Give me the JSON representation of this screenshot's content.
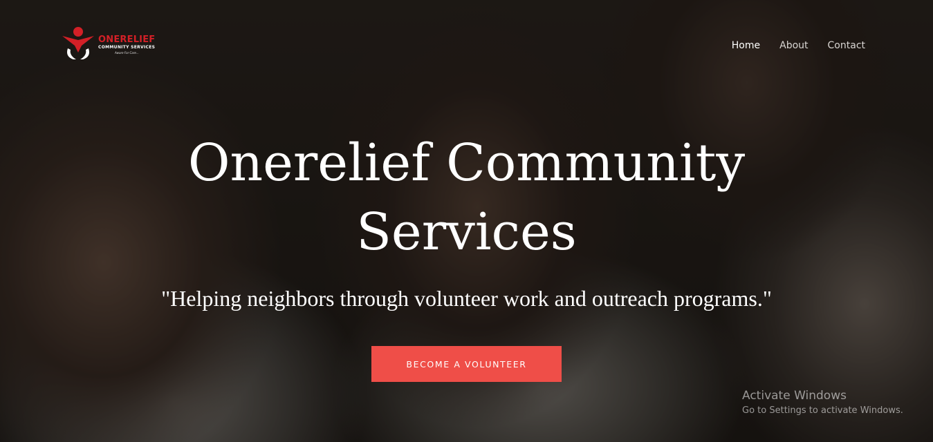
{
  "logo": {
    "name": "ONERELIEF",
    "subtitle": "COMMUNITY SERVICES",
    "tagline": "Aware For Care..."
  },
  "nav": {
    "items": [
      {
        "label": "Home",
        "active": true
      },
      {
        "label": "About",
        "active": false
      },
      {
        "label": "Contact",
        "active": false
      }
    ]
  },
  "hero": {
    "title_line1": "Onerelief Community",
    "title_line2": "Services",
    "tagline": "\"Helping neighbors through volunteer work and outreach programs.\"",
    "cta_label": "BECOME A VOLUNTEER"
  },
  "watermark": {
    "title": "Activate Windows",
    "subtitle": "Go to Settings to activate Windows."
  },
  "colors": {
    "accent": "#ef4e48",
    "logo_red": "#d32027",
    "text": "#ffffff"
  }
}
